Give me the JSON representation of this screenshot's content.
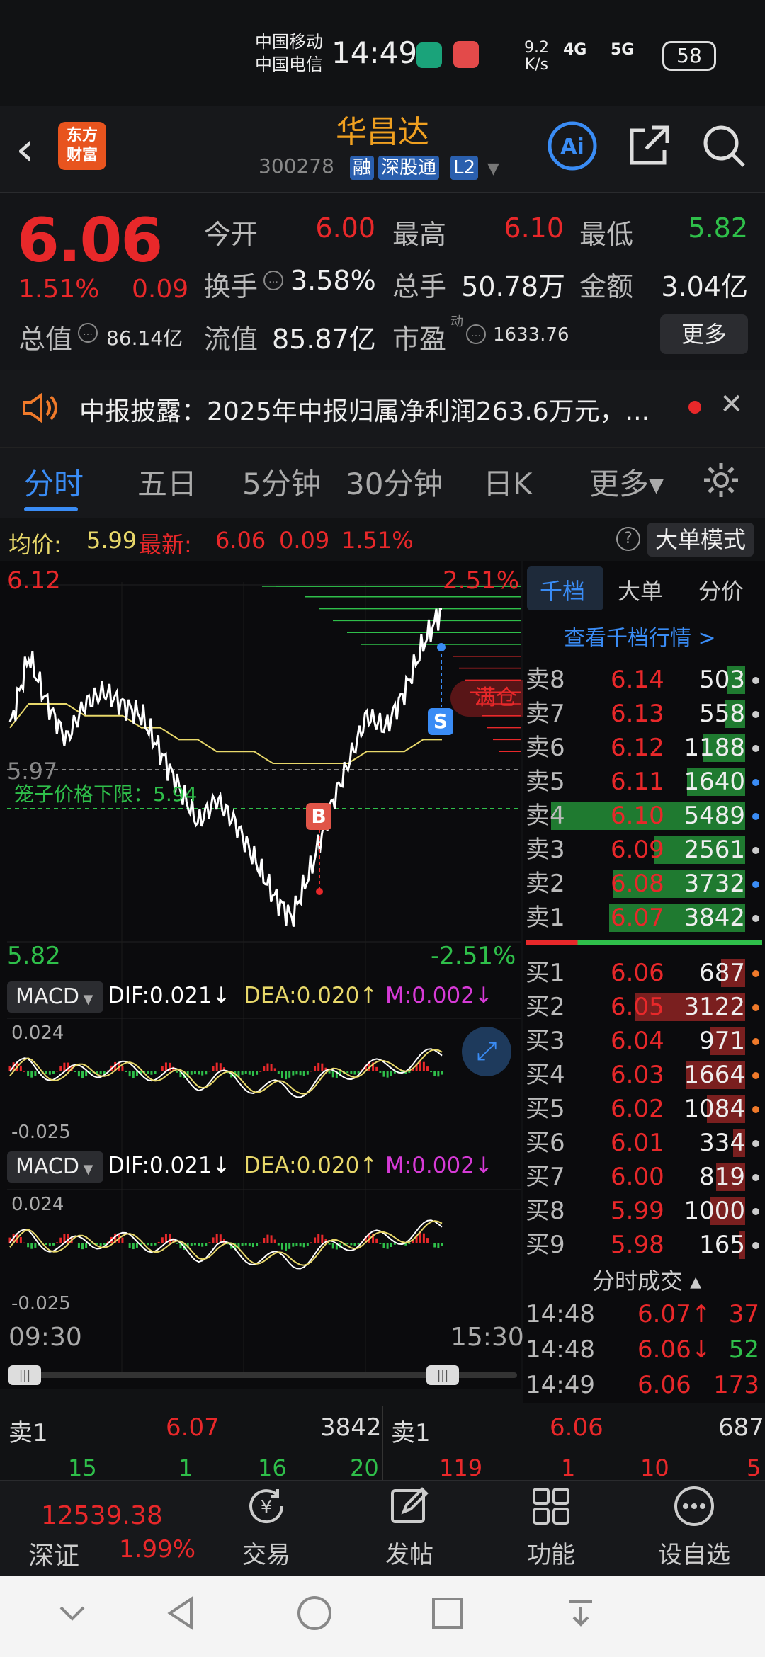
{
  "status_bar": {
    "carrier1": "中国移动",
    "carrier2": "中国电信",
    "time": "14:49",
    "net_rate": "9.2\nK/s",
    "net_4g": "4G",
    "net_5g": "5G",
    "battery": "58"
  },
  "header": {
    "back_icon": "chevron-left-icon",
    "app_logo": "东方\n财富",
    "stock_name": "华昌达",
    "stock_code": "300278",
    "tags": [
      "融",
      "深股通",
      "L2"
    ]
  },
  "quote": {
    "price": "6.06",
    "change_pct": "1.51%",
    "change": "0.09",
    "open_label": "今开",
    "open": "6.00",
    "high_label": "最高",
    "high": "6.10",
    "low_label": "最低",
    "low": "5.82",
    "turnover_label": "换手",
    "turnover": "3.58%",
    "volume_label": "总手",
    "volume": "50.78万",
    "amount_label": "金额",
    "amount": "3.04亿",
    "mktcap_label": "总值",
    "mktcap": "86.14亿",
    "float_label": "流值",
    "float": "85.87亿",
    "pe_label": "市盈",
    "pe_sup": "动",
    "pe": "1633.76",
    "more": "更多"
  },
  "notice": {
    "text": "中报披露：2025年中报归属净利润263.6万元，..."
  },
  "tabs": [
    "分时",
    "五日",
    "5分钟",
    "30分钟",
    "日K",
    "更多▾"
  ],
  "info_bar": {
    "avg_label": "均价:",
    "avg": "5.99",
    "latest_label": "最新:",
    "latest": "6.06",
    "chg": "0.09",
    "pct": "1.51%",
    "mode": "大单模式"
  },
  "chart": {
    "price_top": "6.12",
    "price_bottom": "5.82",
    "pct_top": "2.51%",
    "pct_bottom": "-2.51%",
    "prev_close": "5.97",
    "cage_label": "笼子价格下限：5.94",
    "full_pos": "满仓",
    "b_mark": "B",
    "s_mark": "S",
    "time_start": "09:30",
    "time_end": "15:30"
  },
  "chart_data": {
    "type": "line",
    "x_start": "09:30",
    "x_end": "15:30",
    "ylim": [
      5.82,
      6.12
    ],
    "prev_close": 5.97,
    "x": [
      "09:30",
      "09:40",
      "09:50",
      "10:00",
      "10:10",
      "10:20",
      "10:30",
      "10:40",
      "10:50",
      "11:00",
      "11:10",
      "11:20",
      "11:30",
      "13:10",
      "13:20",
      "13:30",
      "13:40",
      "13:50",
      "14:00",
      "14:10",
      "14:20",
      "14:30",
      "14:40",
      "14:49"
    ],
    "series": [
      {
        "color": "#ffffff",
        "values": [
          6.0,
          6.06,
          6.02,
          5.99,
          6.02,
          6.03,
          6.02,
          6.01,
          5.98,
          5.95,
          5.92,
          5.94,
          5.92,
          5.89,
          5.86,
          5.84,
          5.88,
          5.93,
          5.97,
          6.01,
          6.0,
          6.03,
          6.07,
          6.1
        ]
      },
      {
        "color": "#e8d86a",
        "values": [
          6.0,
          6.02,
          6.02,
          6.02,
          6.01,
          6.01,
          6.01,
          6.0,
          6.0,
          5.99,
          5.99,
          5.98,
          5.98,
          5.98,
          5.97,
          5.97,
          5.97,
          5.97,
          5.97,
          5.98,
          5.98,
          5.98,
          5.99,
          5.99
        ]
      }
    ]
  },
  "macd1": {
    "name": "MACD",
    "dif": "DIF:0.021↓",
    "dea": "DEA:0.020↑",
    "m": "M:0.002↓",
    "top": "0.024",
    "bottom": "-0.025"
  },
  "macd2": {
    "name": "MACD",
    "dif": "DIF:0.021↓",
    "dea": "DEA:0.020↑",
    "m": "M:0.002↓",
    "top": "0.024",
    "bottom": "-0.025"
  },
  "orderbook": {
    "tabs": [
      "千档",
      "大单",
      "分价"
    ],
    "link": "查看千档行情 >",
    "asks": [
      {
        "l": "卖8",
        "p": "6.14",
        "v": "503",
        "dot": "#cccccc"
      },
      {
        "l": "卖7",
        "p": "6.13",
        "v": "558",
        "dot": "#cccccc"
      },
      {
        "l": "卖6",
        "p": "6.12",
        "v": "1188",
        "dot": "#cccccc"
      },
      {
        "l": "卖5",
        "p": "6.11",
        "v": "1640",
        "dot": "#3a8cf5"
      },
      {
        "l": "卖4",
        "p": "6.10",
        "v": "5489",
        "dot": "#3a8cf5"
      },
      {
        "l": "卖3",
        "p": "6.09",
        "v": "2561",
        "dot": "#cccccc"
      },
      {
        "l": "卖2",
        "p": "6.08",
        "v": "3732",
        "dot": "#3a8cf5"
      },
      {
        "l": "卖1",
        "p": "6.07",
        "v": "3842",
        "dot": "#cccccc"
      }
    ],
    "bids": [
      {
        "l": "买1",
        "p": "6.06",
        "v": "687",
        "dot": "#f07a2a"
      },
      {
        "l": "买2",
        "p": "6.05",
        "v": "3122",
        "dot": "#f07a2a"
      },
      {
        "l": "买3",
        "p": "6.04",
        "v": "971",
        "dot": "#f07a2a"
      },
      {
        "l": "买4",
        "p": "6.03",
        "v": "1664",
        "dot": "#f07a2a"
      },
      {
        "l": "买5",
        "p": "6.02",
        "v": "1084",
        "dot": "#f07a2a"
      },
      {
        "l": "买6",
        "p": "6.01",
        "v": "334",
        "dot": "#cccccc"
      },
      {
        "l": "买7",
        "p": "6.00",
        "v": "819",
        "dot": "#cccccc"
      },
      {
        "l": "买8",
        "p": "5.99",
        "v": "1000",
        "dot": "#cccccc"
      },
      {
        "l": "买9",
        "p": "5.98",
        "v": "165",
        "dot": "#cccccc"
      }
    ],
    "trades_title": "分时成交 ▴",
    "trades": [
      {
        "t": "14:48",
        "p": "6.07↑",
        "v": "37",
        "pc": "#e8282a",
        "vc": "#e8282a"
      },
      {
        "t": "14:48",
        "p": "6.06↓",
        "v": "52",
        "pc": "#e8282a",
        "vc": "#2fbf4a"
      },
      {
        "t": "14:49",
        "p": "6.06",
        "v": "173",
        "pc": "#e8282a",
        "vc": "#e8282a"
      }
    ]
  },
  "bottom_bar": {
    "sell_label": "卖1",
    "sell_price": "6.07",
    "sell_vol": "3842",
    "buy_label": "卖1",
    "buy_price": "6.06",
    "buy_vol": "687",
    "nums_left": [
      "15",
      "1",
      "16",
      "20"
    ],
    "nums_right": [
      "119",
      "1",
      "10",
      "5"
    ]
  },
  "nav": {
    "index_value": "12539.38",
    "index_name": "深证",
    "index_pct": "1.99%",
    "items": [
      {
        "label": "交易",
        "icon": "yen-cycle-icon"
      },
      {
        "label": "发帖",
        "icon": "edit-icon"
      },
      {
        "label": "功能",
        "icon": "grid-icon"
      },
      {
        "label": "设自选",
        "icon": "more-circle-icon"
      }
    ]
  }
}
